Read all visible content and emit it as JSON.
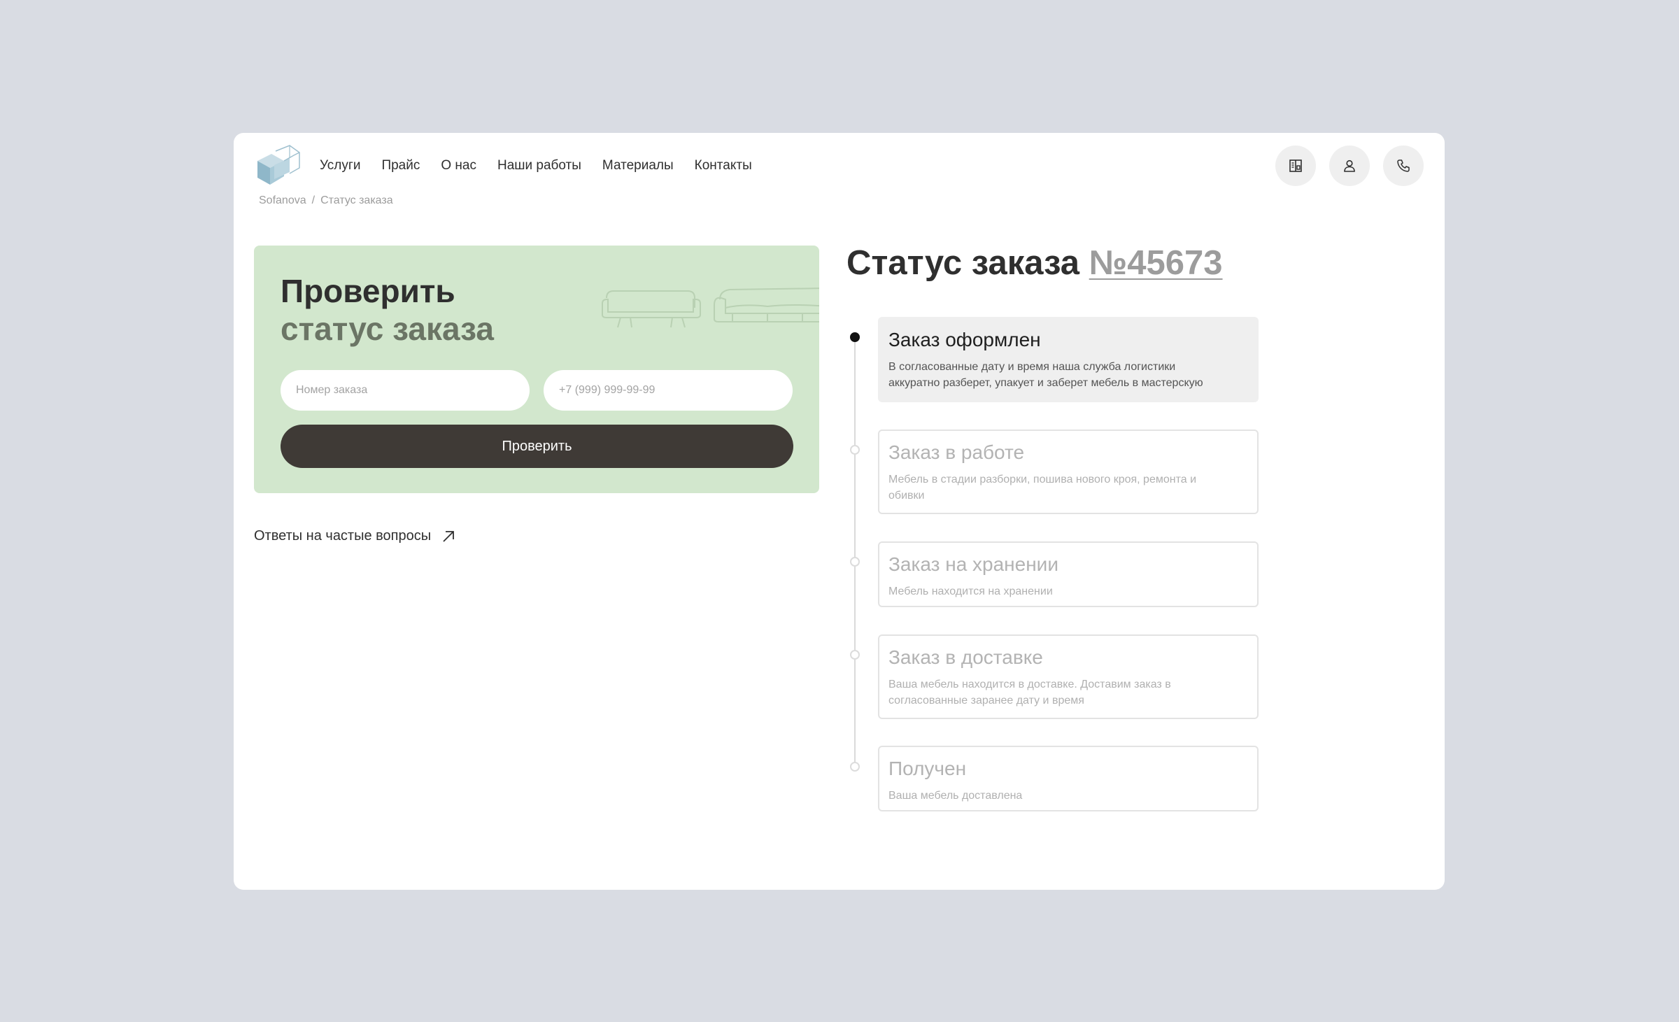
{
  "nav": {
    "items": [
      "Услуги",
      "Прайс",
      "О нас",
      "Наши работы",
      "Материалы",
      "Контакты"
    ]
  },
  "header_icons": [
    "catalog-icon",
    "user-icon",
    "phone-icon"
  ],
  "breadcrumb": {
    "items": [
      "Sofanova",
      "Статус заказа"
    ],
    "separator": "/"
  },
  "check_form": {
    "title_line1": "Проверить",
    "title_line2": "статус заказа",
    "order_placeholder": "Номер заказа",
    "phone_placeholder": "+7 (999) 999-99-99",
    "submit_label": "Проверить",
    "background_color": "#d2e7cd",
    "button_color": "#3f3a36"
  },
  "faq_link": {
    "label": "Ответы на частые вопросы",
    "icon": "arrow-up-right-icon"
  },
  "status": {
    "title_prefix": "Статус заказа",
    "order_number": "№45673",
    "steps": [
      {
        "title": "Заказ оформлен",
        "description": "В согласованные дату и время наша служба логистики аккуратно разберет, упакует и заберет мебель в мастерскую",
        "active": true
      },
      {
        "title": "Заказ в работе",
        "description": "Мебель в стадии разборки, пошива нового кроя, ремонта и обивки",
        "active": false
      },
      {
        "title": "Заказ на хранении",
        "description": "Мебель находится на хранении",
        "active": false
      },
      {
        "title": "Заказ в доставке",
        "description": "Ваша мебель находится в доставке. Доставим заказ в согласованные заранее дату и время",
        "active": false
      },
      {
        "title": "Получен",
        "description": "Ваша мебель доставлена",
        "active": false
      }
    ]
  }
}
